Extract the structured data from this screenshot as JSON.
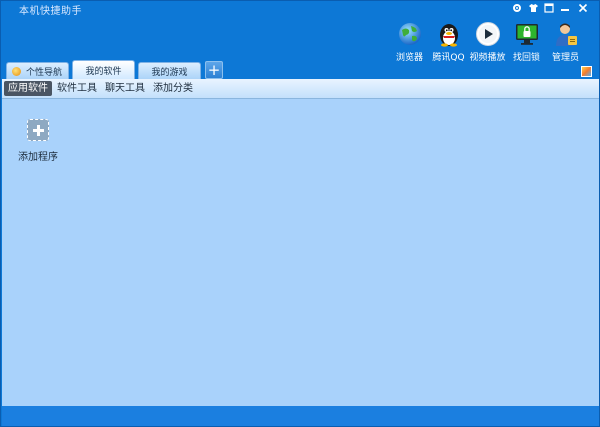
{
  "window": {
    "title": "本机快捷助手"
  },
  "sys_buttons": [
    "settings-icon",
    "skin-icon",
    "restore-icon",
    "minimize-icon",
    "close-icon"
  ],
  "quick_launch": [
    {
      "label": "浏览器",
      "icon": "globe-icon"
    },
    {
      "label": "腾讯QQ",
      "icon": "qq-penguin-icon"
    },
    {
      "label": "视频播放",
      "icon": "play-icon"
    },
    {
      "label": "找回锁",
      "icon": "lock-screen-icon"
    },
    {
      "label": "管理员",
      "icon": "admin-user-icon"
    }
  ],
  "tabs": [
    {
      "label": "个性导航",
      "active": false
    },
    {
      "label": "我的软件",
      "active": true
    },
    {
      "label": "我的游戏",
      "active": false
    }
  ],
  "tab_add_label": "+",
  "categories": [
    {
      "label": "应用软件",
      "active": true
    },
    {
      "label": "软件工具",
      "active": false
    },
    {
      "label": "聊天工具",
      "active": false
    },
    {
      "label": "添加分类",
      "active": false
    }
  ],
  "content": {
    "add_program_label": "添加程序"
  },
  "colors": {
    "frame": "#0d78d6",
    "content_bg": "#a9d2fb",
    "category_active_bg": "#4a5563"
  }
}
